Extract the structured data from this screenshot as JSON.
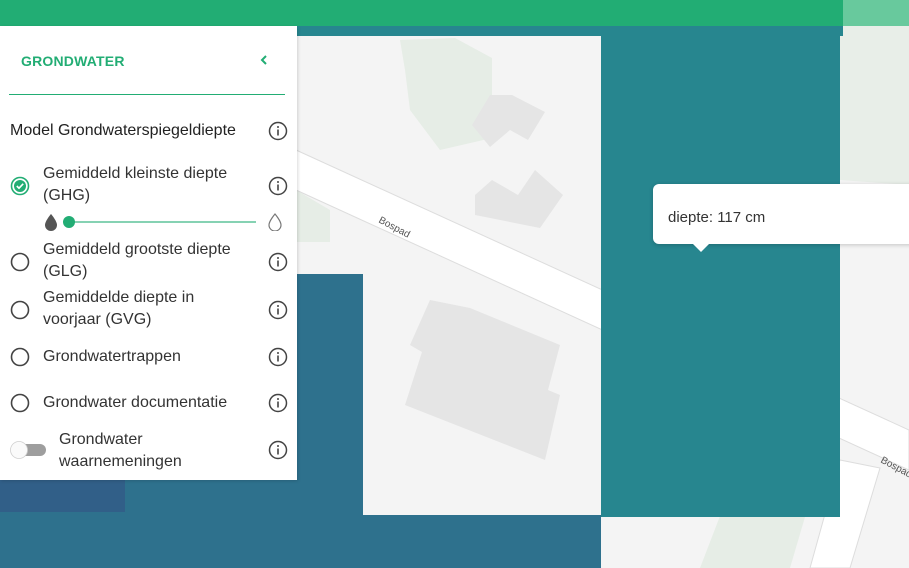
{
  "panel": {
    "title": "GRONDWATER",
    "model_title": "Model Grondwaterspiegeldiepte",
    "options": [
      {
        "label_line1": "Gemiddeld kleinste diepte",
        "label_line2": "(GHG)",
        "selected": true
      },
      {
        "label_line1": "Gemiddeld grootste diepte",
        "label_line2": "(GLG)",
        "selected": false
      },
      {
        "label_line1": "Gemiddelde diepte in",
        "label_line2": "voorjaar (GVG)",
        "selected": false
      },
      {
        "label_line1": "Grondwatertrappen",
        "selected": false
      },
      {
        "label_line1": "Grondwater documentatie",
        "selected": false
      }
    ],
    "slider": {
      "opacity_value": 0
    },
    "toggle": {
      "label_line1": "Grondwater",
      "label_line2": "waarnemeningen",
      "on": false
    }
  },
  "map": {
    "street_labels": [
      "Bospad",
      "Bospad"
    ]
  },
  "tooltip": {
    "text": "diepte: 117 cm"
  },
  "colors": {
    "accent": "#22ad74",
    "depth_dark": "#2e718d",
    "depth_teal": "#27868f"
  },
  "icons": [
    "chevron-left-icon",
    "info-icon",
    "radio-checked-icon",
    "radio-empty-icon",
    "drop-filled-icon",
    "drop-outline-icon",
    "toggle-switch"
  ]
}
